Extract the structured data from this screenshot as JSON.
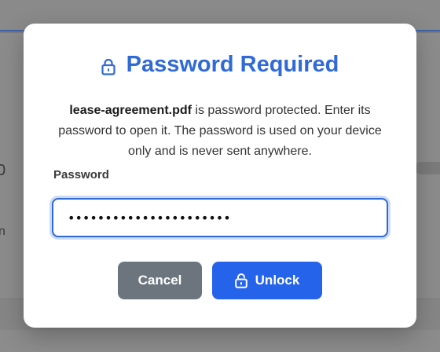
{
  "dialog": {
    "title": "Password Required",
    "title_icon": "lock-icon",
    "filename": "lease-agreement.pdf",
    "message": " is password protected. Enter its password to open it. The password is used on your device only and is never sent anywhere.",
    "field_label": "Password",
    "password_value": "••••••••••••••••••••••",
    "cancel_label": "Cancel",
    "unlock_label": "Unlock",
    "unlock_icon": "unlock-icon"
  },
  "background": {
    "fragment_1": "0",
    "fragment_2": "n"
  },
  "colors": {
    "accent": "#2f6ad6",
    "primary_button": "#2563eb",
    "secondary_button": "#6c757d",
    "overlay": "#7b7b7b"
  }
}
